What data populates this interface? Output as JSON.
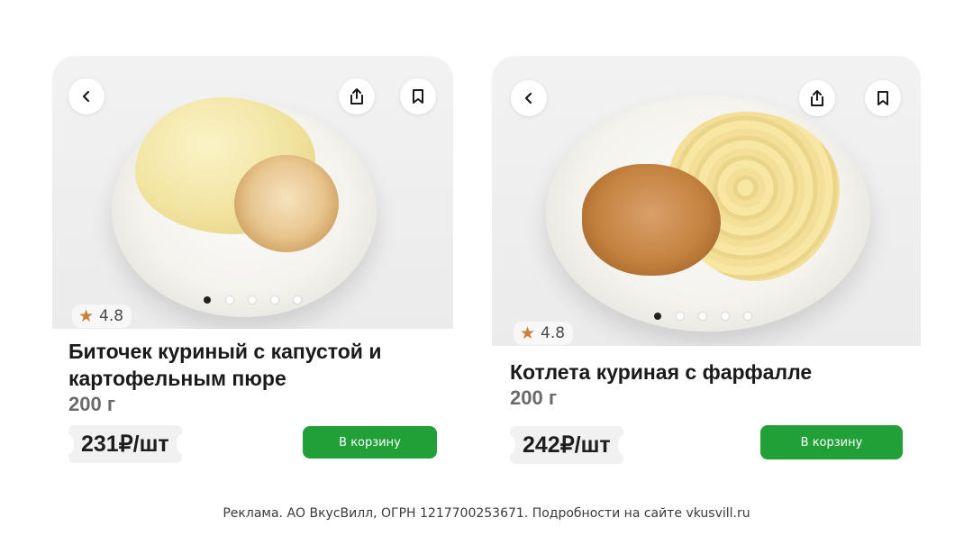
{
  "products": [
    {
      "title_line1": "Биточек куриный с капустой и",
      "title_line2": "картофельным пюре",
      "weight": "200 г",
      "rating": "4.8",
      "price": "231₽/шт",
      "cart_label": "В корзину",
      "image_dots_total": 5,
      "image_dots_active": 1
    },
    {
      "title_line1": "Котлета куриная с фарфалле",
      "title_line2": "",
      "weight": "200 г",
      "rating": "4.8",
      "price": "242₽/шт",
      "cart_label": "В корзину",
      "image_dots_total": 5,
      "image_dots_active": 1
    }
  ],
  "footer": {
    "disclaimer": "Реклама. АО ВкусВилл, ОГРН 1217700253671. Подробности на сайте vkusvill.ru"
  },
  "icons": {
    "back": "chevron-left-icon",
    "share": "share-icon",
    "bookmark": "bookmark-icon",
    "rating": "star-icon"
  },
  "colors": {
    "accent_green": "#21a038",
    "star": "#c8803b",
    "price_bg": "#f1f1f1"
  }
}
